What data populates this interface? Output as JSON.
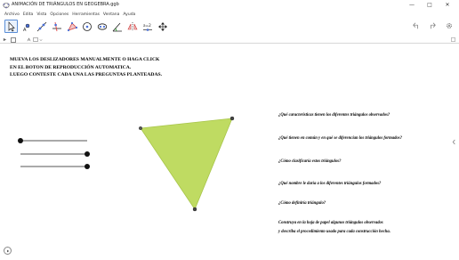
{
  "window": {
    "title": "ANIMACIÓN DE TRIÁNGULOS EN GEOGEBRA.ggb",
    "minimize_glyph": "—",
    "maximize_glyph": "□",
    "close_glyph": "✕"
  },
  "menu": [
    "Archivo",
    "Edita",
    "Vista",
    "Opciones",
    "Herramientas",
    "Ventana",
    "Ayuda"
  ],
  "toolbar": {
    "tools": [
      "move-tool",
      "point-tool",
      "line-tool",
      "perpendicular-tool",
      "polygon-tool",
      "circle-tool",
      "ellipse-tool",
      "angle-tool",
      "reflect-tool",
      "slider-tool",
      "move-view-tool"
    ],
    "slider_tool_label": "a=2"
  },
  "instructions": [
    "MUEVA LOS DESLIZADORES MANUALMENTE O HAGA CLICK",
    "EN EL BOTON DE REPRODUCCIÓN AUTOMATICA.",
    "LUEGO CONTESTE CADA UNA LAS PREGUNTAS PLANTEADAS."
  ],
  "questions": [
    "¿Qué características tienen los diferentes triángulos observados?",
    "¿Qué tienen en común y en qué se diferencian los triángulos formados?",
    "¿Cómo clasificaría estos triángulos?",
    "¿Qué nombre le daría a los diferentes triángulos formados?",
    "¿Cómo definiría triángulo?"
  ],
  "final_task": [
    "Construya en la hoja de papel algunos triángulos observados",
    "y describa el procedimiento usado para cada construcción hecha."
  ],
  "sliders": [
    0.0,
    1.0,
    1.0
  ],
  "colors": {
    "triangle_fill": "#bcd95a",
    "slider_line": "#555555",
    "active_tool_border": "#5a8ed6"
  }
}
